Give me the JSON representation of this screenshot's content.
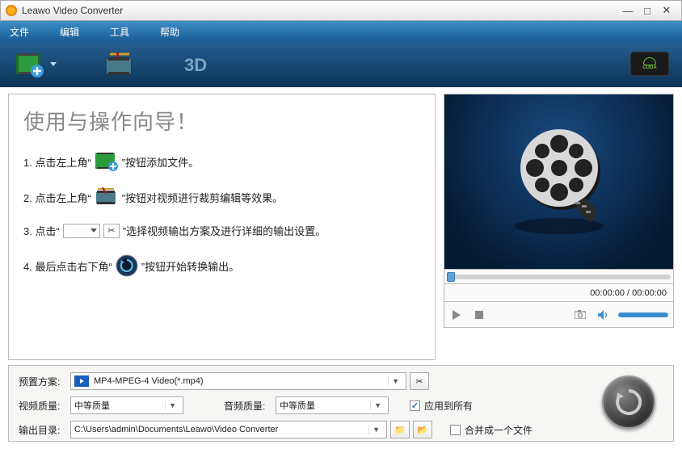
{
  "title": "Leawo Video Converter",
  "menu": {
    "file": "文件",
    "edit": "编辑",
    "tools": "工具",
    "help": "帮助"
  },
  "cuda": "CUDA",
  "wizard": {
    "heading": "使用与操作向导！",
    "step1a": "1. 点击左上角“",
    "step1b": "”按钮添加文件。",
    "step2a": "2. 点击左上角“",
    "step2b": "”按钮对视频进行裁剪编辑等效果。",
    "step3a": "3. 点击“",
    "step3b": "”选择视频输出方案及进行详细的输出设置。",
    "step4a": "4. 最后点击右下角“",
    "step4b": "”按钮开始转换输出。"
  },
  "player": {
    "time": "00:00:00 / 00:00:00"
  },
  "bottom": {
    "preset_label": "预置方案:",
    "preset_value": "MP4-MPEG-4 Video(*.mp4)",
    "vquality_label": "视频质量:",
    "vquality_value": "中等质量",
    "aquality_label": "音频质量:",
    "aquality_value": "中等质量",
    "apply_all": "应用到所有",
    "output_label": "输出目录:",
    "output_value": "C:\\Users\\admin\\Documents\\Leawo\\Video Converter",
    "merge": "合并成一个文件"
  }
}
